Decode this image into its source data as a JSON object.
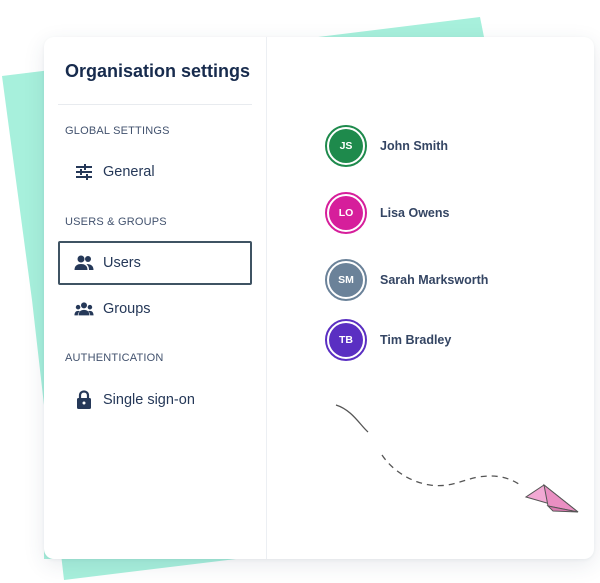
{
  "colors": {
    "mint": "#a7f0dc",
    "title": "#172b4d",
    "active_border": "#3f5363",
    "plane": "#f2a9d4"
  },
  "sidebar": {
    "title": "Organisation settings",
    "sections": [
      {
        "label": "GLOBAL SETTINGS"
      },
      {
        "label": "USERS & GROUPS"
      },
      {
        "label": "AUTHENTICATION"
      }
    ],
    "items": [
      {
        "label": "General",
        "icon": "sliders-icon"
      },
      {
        "label": "Users",
        "icon": "users-icon",
        "active": true
      },
      {
        "label": "Groups",
        "icon": "groups-icon"
      },
      {
        "label": "Single sign-on",
        "icon": "lock-icon"
      }
    ]
  },
  "users": [
    {
      "initials": "JS",
      "name": "John Smith",
      "color": "#1e8a4c"
    },
    {
      "initials": "LO",
      "name": "Lisa Owens",
      "color": "#d61e9b"
    },
    {
      "initials": "SM",
      "name": "Sarah Marksworth",
      "color": "#6b8299"
    },
    {
      "initials": "TB",
      "name": "Tim Bradley",
      "color": "#5a2fc2"
    }
  ],
  "decoration": {
    "paper_plane": "paper-plane-icon"
  }
}
